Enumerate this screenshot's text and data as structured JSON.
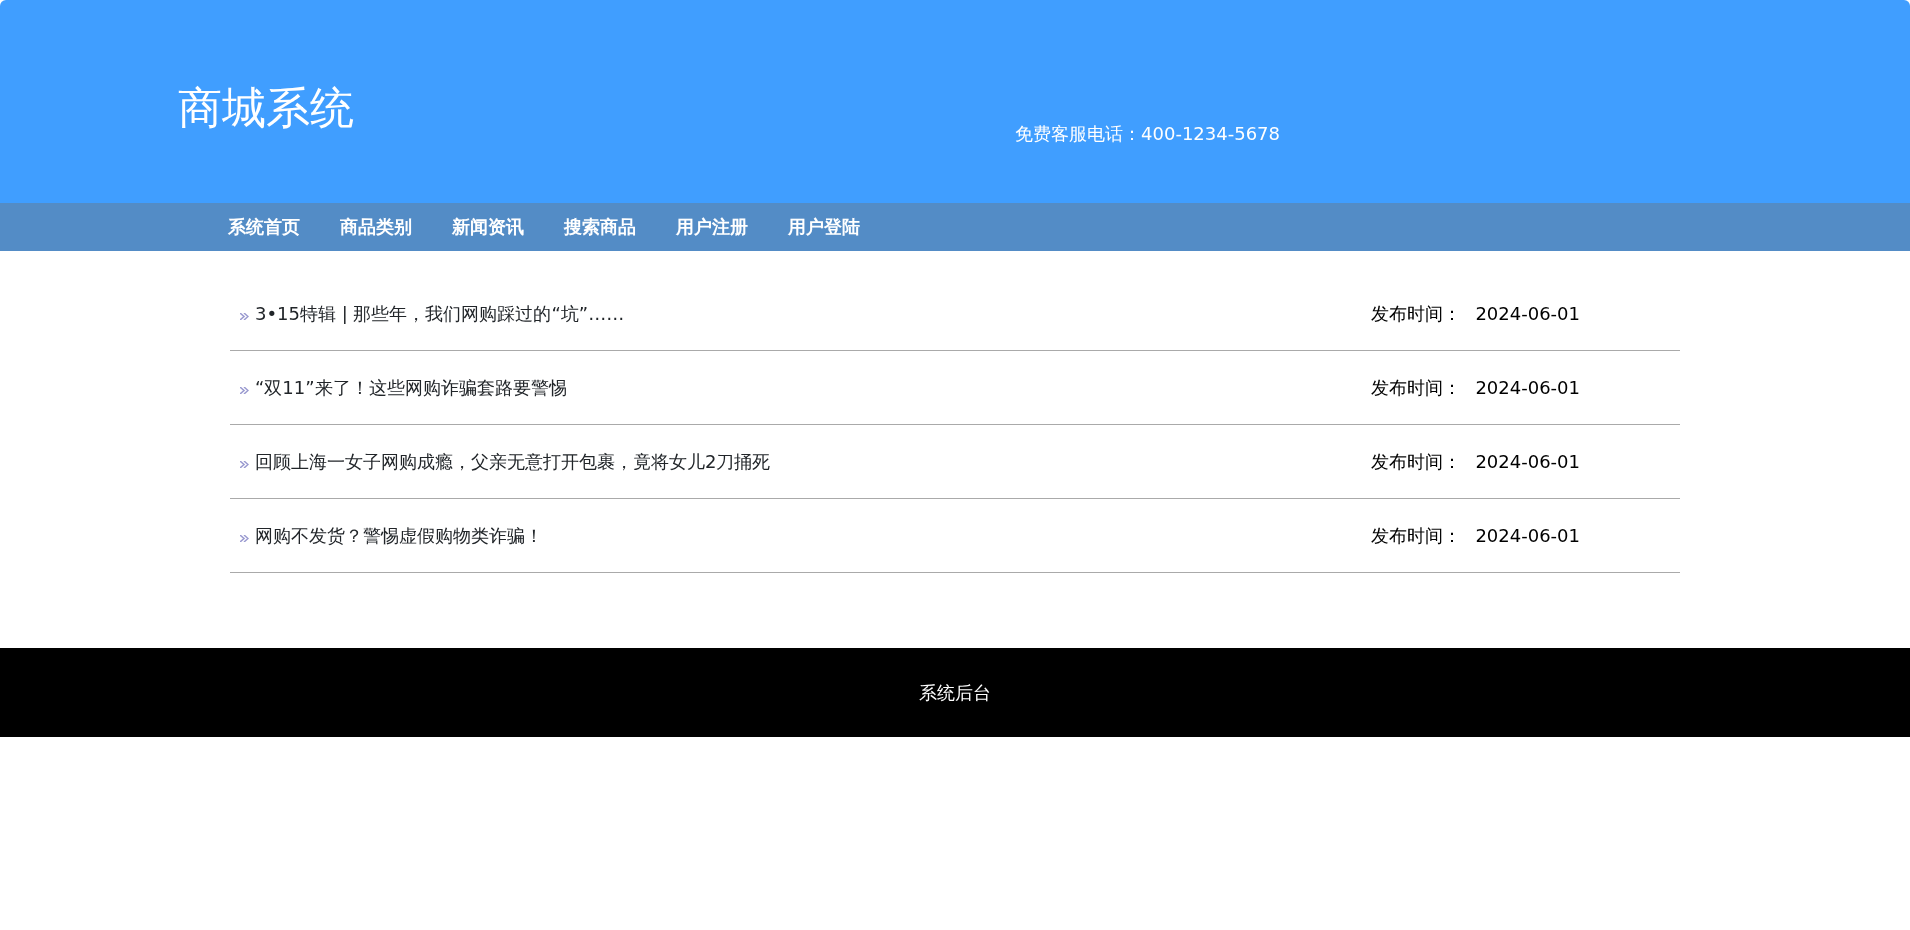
{
  "header": {
    "title": "商城系统",
    "hotline": "免费客服电话：400-1234-5678"
  },
  "nav": [
    "系统首页",
    "商品类别",
    "新闻资讯",
    "搜索商品",
    "用户注册",
    "用户登陆"
  ],
  "news": [
    {
      "title": "3•15特辑 | 那些年，我们网购踩过的“坑”……",
      "date_label": "发布时间：",
      "date": "2024-06-01"
    },
    {
      "title": "“双11”来了！这些网购诈骗套路要警惕",
      "date_label": "发布时间：",
      "date": "2024-06-01"
    },
    {
      "title": "回顾上海一女子网购成瘾，父亲无意打开包裹，竟将女儿2刀捅死",
      "date_label": "发布时间：",
      "date": "2024-06-01"
    },
    {
      "title": "网购不发货？警惕虚假购物类诈骗！",
      "date_label": "发布时间：",
      "date": "2024-06-01"
    }
  ],
  "footer": {
    "link": "系统后台"
  }
}
